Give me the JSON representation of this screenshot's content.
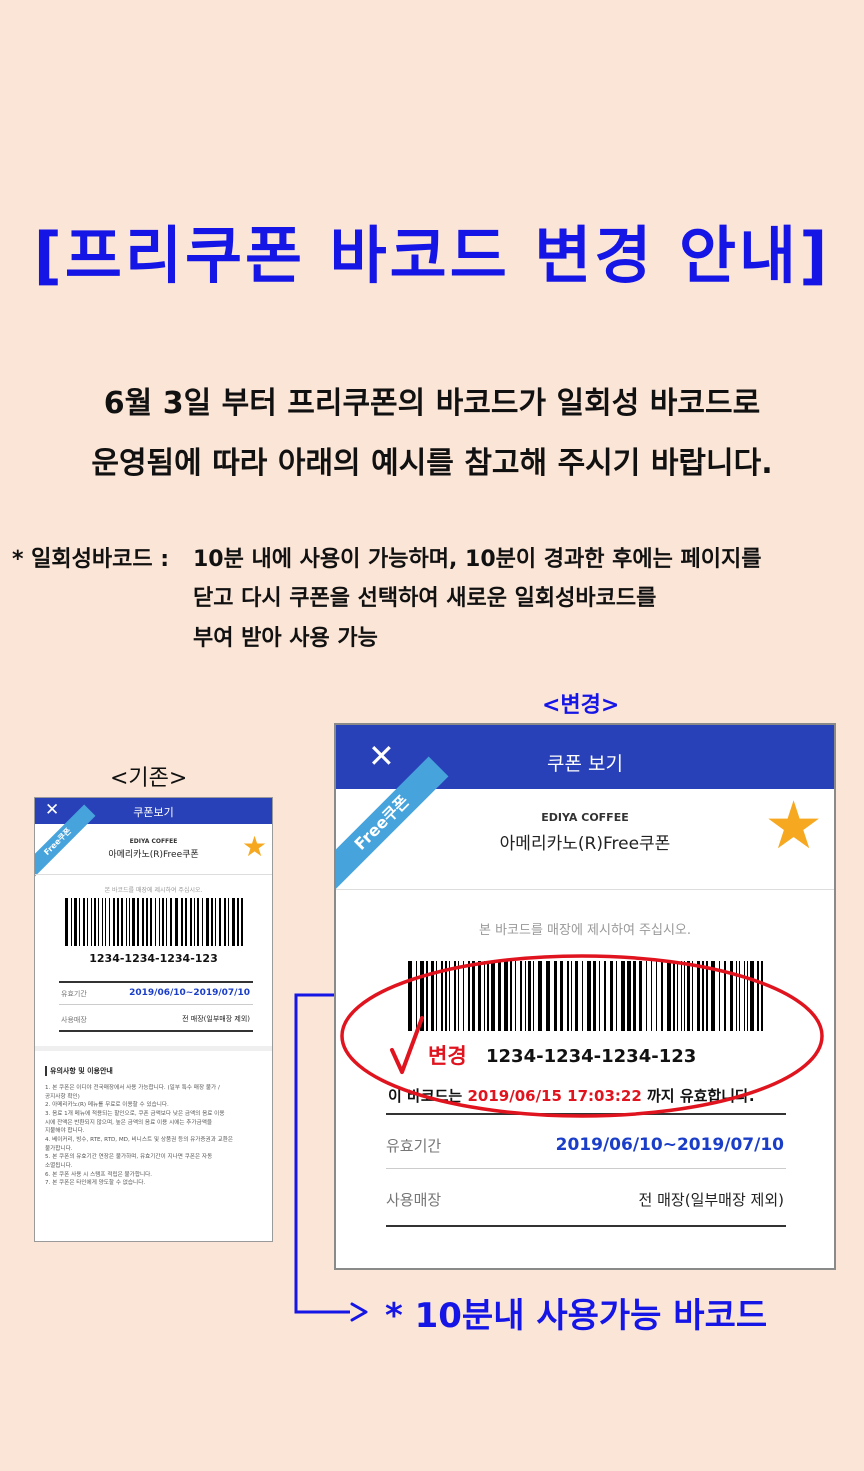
{
  "title": "[프리쿠폰 바코드 변경 안내]",
  "intro": {
    "line1": "6월 3일 부터 프리쿠폰의 바코드가 일회성 바코드로",
    "line2": "운영됨에 따라 아래의 예시를 참고해 주시기 바랍니다."
  },
  "note": {
    "prefix": "* 일회성바코드 :",
    "line1": "10분 내에 사용이 가능하며, 10분이 경과한 후에는 페이지를",
    "line2": "닫고 다시 쿠폰을 선택하여 새로운 일회성바코드를",
    "line3": "부여 받아 사용 가능"
  },
  "old": {
    "caption": "<기존>",
    "header_title": "쿠폰보기",
    "ribbon": "Free쿠폰",
    "brand": "EDIYA COFFEE",
    "product": "아메리카노(R)Free쿠폰",
    "hint": "본 바코드를 매장에 제시하여 주십시오.",
    "code": "1234-1234-1234-123",
    "valid_label": "유효기간",
    "valid_value": "2019/06/10~2019/07/10",
    "store_label": "사용매장",
    "store_value": "전 매장(일부매장 제외)",
    "guide_title": "유의사항 및 이용안내",
    "guide_lines": [
      "1. 본 쿠폰은 이디야 전국매장에서 사용 가능합니다. (일부 특수 매장 불가 /",
      "공지사항 확인)",
      "2. 아메리카노(R) 메뉴를 무료로 이용할 수 있습니다.",
      "3. 음료 1개 메뉴에 적용되는 할인으로, 쿠폰 금액보다 낮은 금액의 음료 이용",
      "시에 잔액은 반환되지 않으며, 높은 금액의 음료 이용 시에는 추가금액을",
      "지불해야 합니다.",
      "4. 베이커리, 빙수, RTE, RTD, MD, 비니스트 및 상품권 등의 유가증권과 교환은",
      "불가합니다.",
      "5. 본 쿠폰의 유효기간 연장은 불가하며, 유효기간이 지나면 쿠폰은 자동",
      "소멸됩니다.",
      "6. 본 쿠폰 사용 시 스탬프 적립은 불가합니다.",
      "7. 본 쿠폰은 타인에게 양도할 수 없습니다."
    ]
  },
  "new": {
    "caption": "<변경>",
    "header_title": "쿠폰 보기",
    "ribbon": "Free쿠폰",
    "brand": "EDIYA COFFEE",
    "product": "아메리카노(R)Free쿠폰",
    "hint": "본 바코드를 매장에 제시하여 주십시오.",
    "code": "1234-1234-1234-123",
    "changed_mark": "변경",
    "expiry_prefix": "이 바코드는",
    "expiry_time": "2019/06/15 17:03:22",
    "expiry_suffix": "까지 유효합니다.",
    "valid_label": "유효기간",
    "valid_value": "2019/06/10~2019/07/10",
    "store_label": "사용매장",
    "store_value": "전 매장(일부매장 제외)"
  },
  "callout": "* 10분내 사용가능 바코드",
  "colors": {
    "background": "#fbe5d6",
    "accent_blue": "#1515e6",
    "header_blue": "#2941b8",
    "highlight_red": "#e0141e",
    "star": "#f6a821",
    "ribbon": "#46a3dc"
  }
}
